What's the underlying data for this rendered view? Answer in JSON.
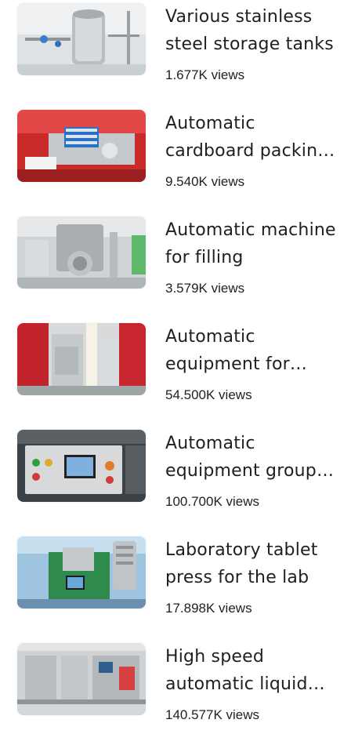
{
  "items": [
    {
      "title": "Various stainless steel storage tanks",
      "views": "1.677K views",
      "thumb": "storage-tank-photo"
    },
    {
      "title": "Automatic cardboard packing machine",
      "views": "9.540K views",
      "thumb": "cardboard-machine-photo"
    },
    {
      "title": "Automatic machine for filling",
      "views": "3.579K views",
      "thumb": "filling-machine-photo"
    },
    {
      "title": "Automatic equipment for packaging",
      "views": "54.500K views",
      "thumb": "packaging-equipment-photo"
    },
    {
      "title": "Automatic equipment group for production",
      "views": "100.700K views",
      "thumb": "control-panel-photo"
    },
    {
      "title": "Laboratory tablet press for the lab",
      "views": "17.898K views",
      "thumb": "tablet-press-photo"
    },
    {
      "title": "High speed automatic liquid filling line",
      "views": "140.577K views",
      "thumb": "liquid-filling-line-photo"
    }
  ]
}
